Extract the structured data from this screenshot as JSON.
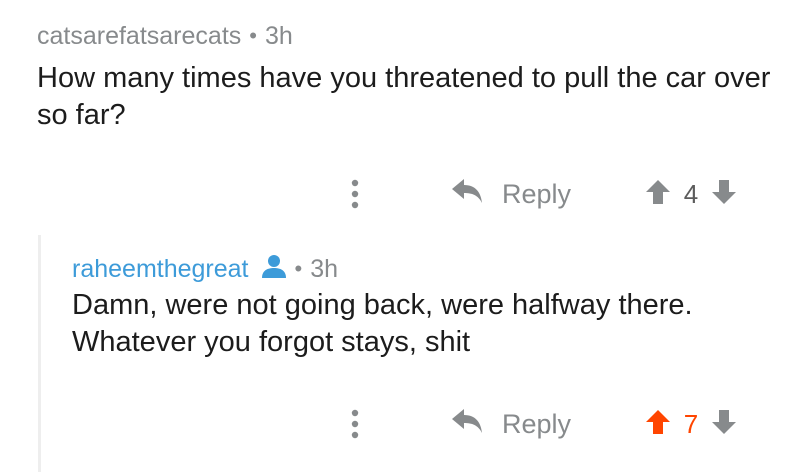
{
  "comments": [
    {
      "author": "catsarefatsarecats",
      "separator": "•",
      "time": "3h",
      "body": "How many times have you threatened to pull the car over so far?",
      "reply_label": "Reply",
      "score": "4",
      "upvoted": false
    },
    {
      "author": "raheemthegreat",
      "separator": "•",
      "time": "3h",
      "body": "Damn, were not going back, were halfway there. Whatever you forgot stays, shit",
      "reply_label": "Reply",
      "score": "7",
      "upvoted": true
    }
  ],
  "colors": {
    "upvote_active": "#ff4500",
    "muted": "#878a8c",
    "author_link": "#3d9bd9",
    "thread_line": "#eeeeee"
  },
  "icons": {
    "more": "vertical-ellipsis-icon",
    "reply": "reply-arrow-icon",
    "upvote": "up-arrow-icon",
    "downvote": "down-arrow-icon",
    "user": "user-icon"
  }
}
